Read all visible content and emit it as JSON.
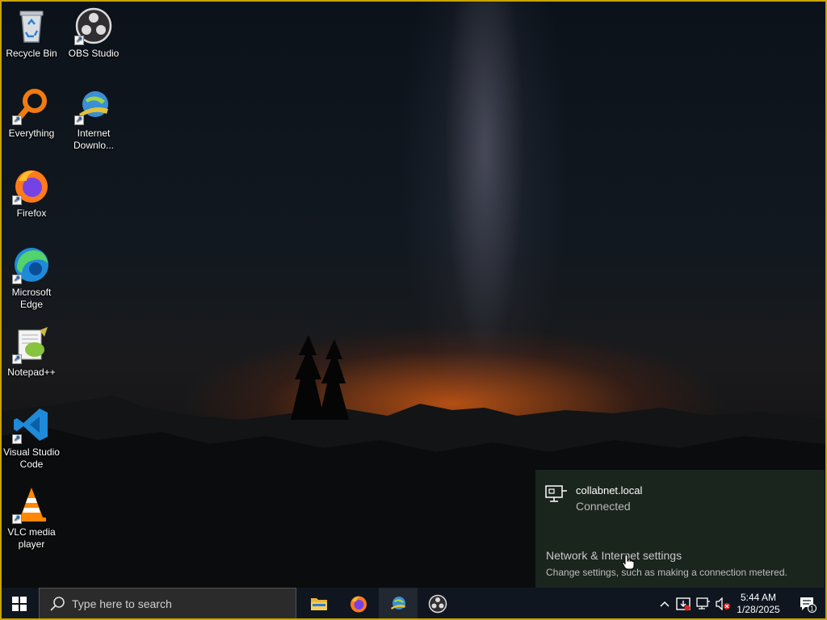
{
  "desktop": {
    "icons": [
      {
        "label": "Recycle Bin",
        "icon": "recycle-bin-icon"
      },
      {
        "label": "OBS Studio",
        "icon": "obs-studio-icon"
      },
      {
        "label": "Everything",
        "icon": "everything-search-icon"
      },
      {
        "label": "Internet Downlo...",
        "icon": "internet-download-manager-icon"
      },
      {
        "label": "Firefox",
        "icon": "firefox-icon"
      },
      {
        "label": "Microsoft Edge",
        "icon": "edge-icon"
      },
      {
        "label": "Notepad++",
        "icon": "notepad-plus-plus-icon"
      },
      {
        "label": "Visual Studio Code",
        "icon": "vscode-icon"
      },
      {
        "label": "VLC media player",
        "icon": "vlc-icon"
      }
    ]
  },
  "network_flyout": {
    "network_name": "collabnet.local",
    "status": "Connected",
    "settings_link": "Network & Internet settings",
    "settings_description": "Change settings, such as making a connection metered."
  },
  "taskbar": {
    "search_placeholder": "Type here to search",
    "pinned": [
      "file-explorer-icon",
      "firefox-icon",
      "internet-download-manager-icon",
      "obs-studio-icon"
    ],
    "tray": [
      "chevron-up-icon",
      "idm-tray-icon",
      "network-icon",
      "volume-muted-icon"
    ],
    "time": "5:44 AM",
    "date": "1/28/2025",
    "notification_count": "1"
  },
  "colors": {
    "frame": "#c9a400",
    "flyout_bg": "#1c2820",
    "taskbar_bg": "#0f1620"
  }
}
